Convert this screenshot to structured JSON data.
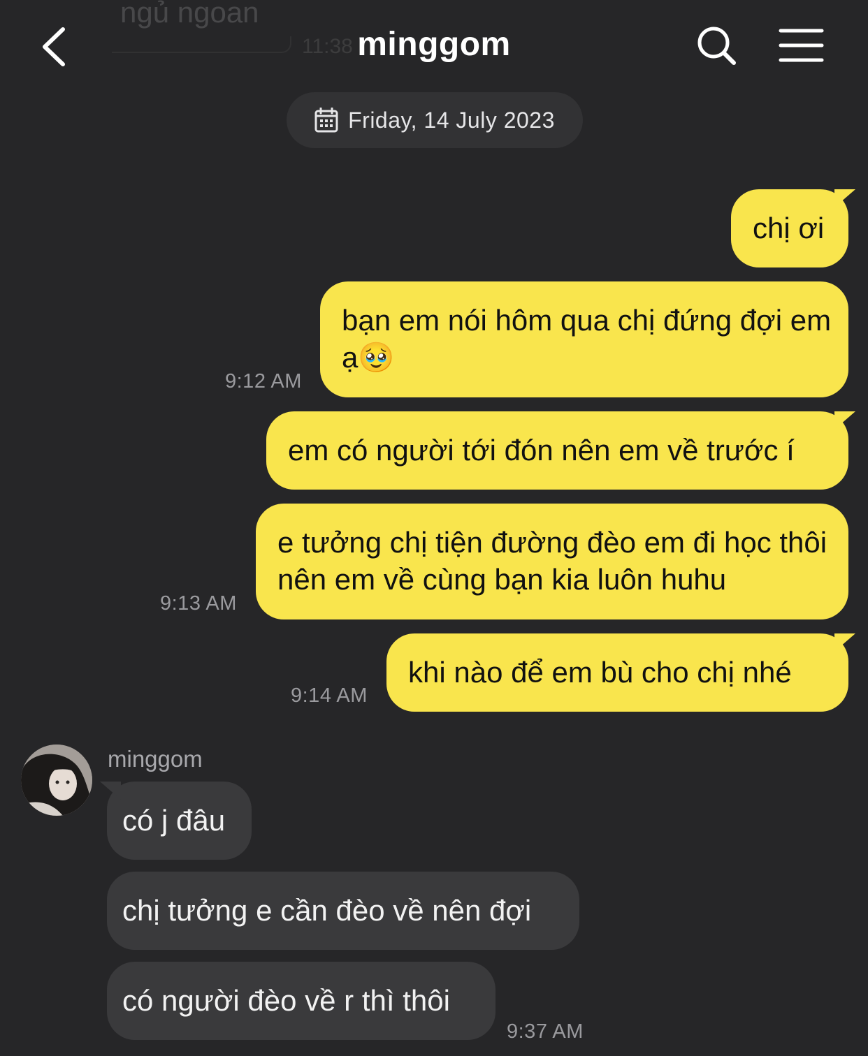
{
  "background_overlay": {
    "text": "ngủ ngoan",
    "time": "11:38"
  },
  "header": {
    "title": "minggom",
    "back_icon": "chevron-left-icon",
    "search_icon": "search-icon",
    "menu_icon": "hamburger-menu-icon"
  },
  "date_divider": {
    "label": "Friday, 14 July 2023",
    "icon": "calendar-icon"
  },
  "colors": {
    "background": "#262628",
    "outgoing_bubble": "#f9e54d",
    "incoming_bubble": "#3a3a3c",
    "timestamp": "#9a9a9e"
  },
  "messages": [
    {
      "direction": "outgoing",
      "text": "chị ơi"
    },
    {
      "direction": "outgoing",
      "text": "bạn em nói hôm qua chị đứng đợi em ạ🥹",
      "time": "9:12 AM"
    },
    {
      "direction": "outgoing",
      "text": "em có người tới đón nên em về trước í"
    },
    {
      "direction": "outgoing",
      "text": "e tưởng chị tiện đường đèo em đi học thôi nên em về cùng bạn kia luôn huhu",
      "time": "9:13 AM"
    },
    {
      "direction": "outgoing",
      "text": "khi nào để em bù cho chị nhé",
      "time": "9:14 AM"
    },
    {
      "direction": "incoming",
      "sender": "minggom",
      "text": "có j đâu"
    },
    {
      "direction": "incoming",
      "text": "chị tưởng e cần đèo về nên đợi"
    },
    {
      "direction": "incoming",
      "text": "có người đèo về r thì thôi",
      "time": "9:37 AM"
    }
  ]
}
